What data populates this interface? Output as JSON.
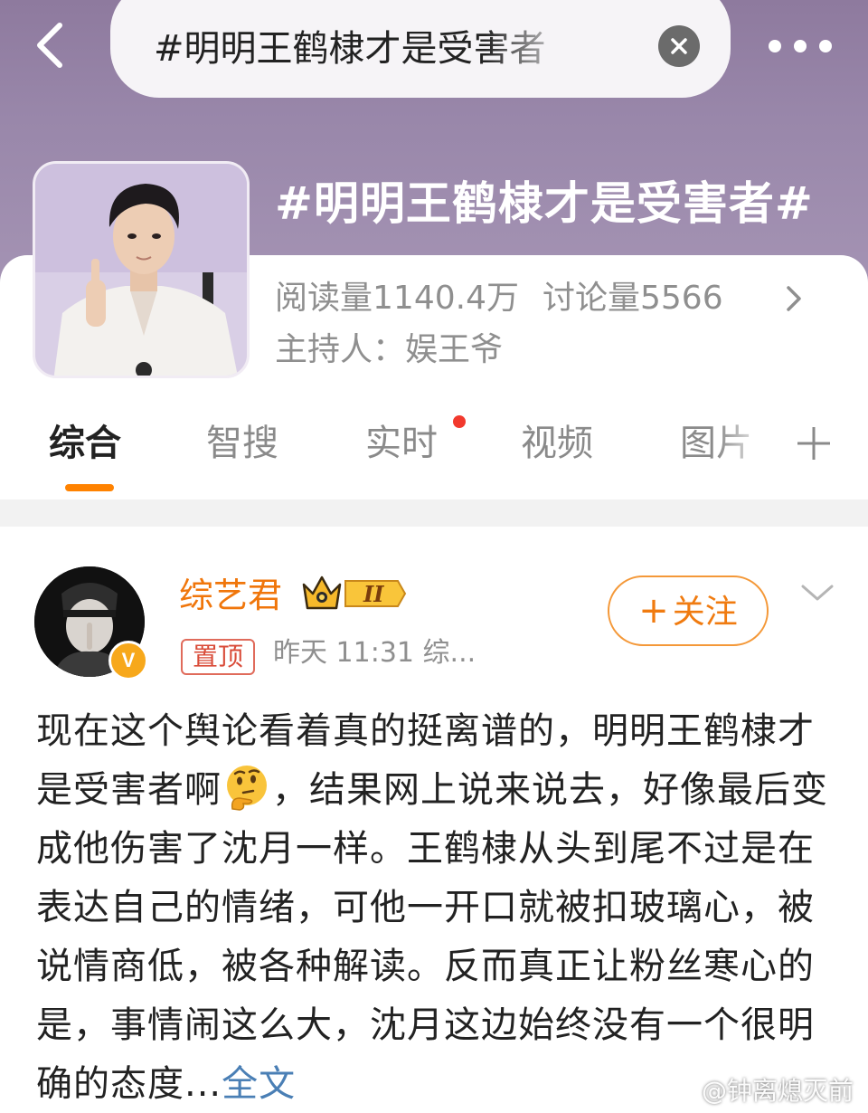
{
  "search": {
    "query": "#明明王鹤棣才是受害者"
  },
  "topic": {
    "title": "#明明王鹤棣才是受害者#",
    "reads_label": "阅读量",
    "reads_value": "1140.4万",
    "discussion_label": "讨论量",
    "discussion_value": "5566",
    "host_label": "主持人：",
    "host_name": "娱王爷"
  },
  "tabs": [
    {
      "label": "综合",
      "active": true
    },
    {
      "label": "智搜"
    },
    {
      "label": "实时",
      "has_dot": true
    },
    {
      "label": "视频"
    },
    {
      "label": "图片"
    }
  ],
  "post": {
    "author": "综艺君",
    "level_badge": "II",
    "verified_badge": "V",
    "pin_label": "置顶",
    "meta": "昨天 11:31  综...",
    "follow_label": "关注",
    "body_part1": "现在这个舆论看着真的挺离谱的，明明王鹤棣才是受害者啊",
    "body_part2": "，结果网上说来说去，好像最后变成他伤害了沈月一样。王鹤棣从头到尾不过是在表达自己的情绪，可他一开口就被扣玻璃心，被说情商低，被各种解读。反而真正让粉丝寒心的是，事情闹这么大，沈月这边始终没有一个很明确的态度",
    "ellipsis": "...",
    "expand_label": "全文"
  },
  "watermark": "@钟离熄灭前",
  "icons": {
    "back": "back-arrow-icon",
    "clear": "clear-icon",
    "more": "more-icon",
    "chevron": "chevron-right-icon",
    "plus": "plus-icon",
    "dropdown": "chevron-down-icon",
    "emoji": "thinking-face-emoji"
  },
  "colors": {
    "accent": "#ff8200",
    "username": "#f0760b",
    "link": "#4a7fb5",
    "live_dot": "#f2392d"
  }
}
